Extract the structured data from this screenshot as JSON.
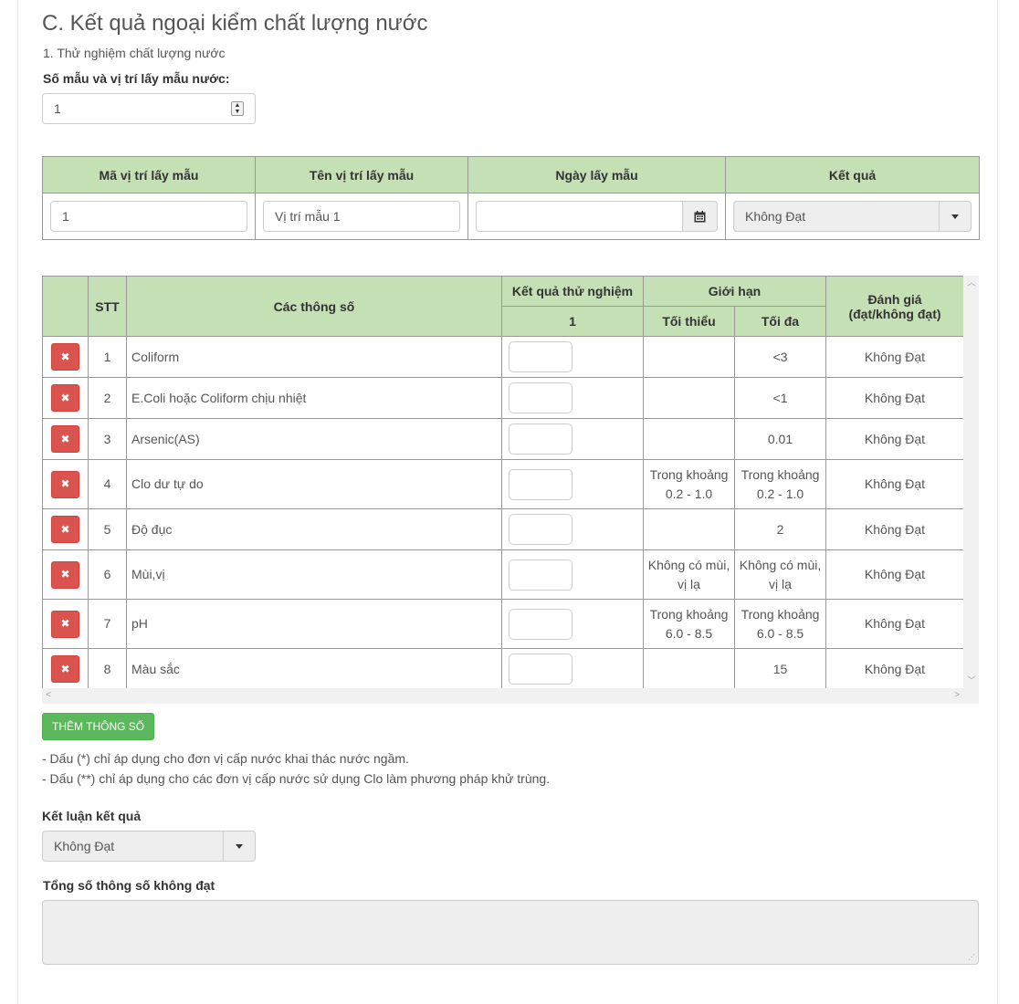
{
  "section": {
    "title": "C. Kết quả ngoại kiểm chất lượng nước",
    "subtitle": "1. Thử nghiệm chất lượng nước",
    "sample_label": "Số mẫu và vị trí lấy mẫu nước:",
    "sample_count": "1"
  },
  "location_table": {
    "headers": [
      "Mã vị trí lấy mẫu",
      "Tên vị trí lấy mẫu",
      "Ngày lấy mẫu",
      "Kết quả"
    ],
    "row": {
      "code": "1",
      "name": "Vị trí mẫu 1",
      "date": "",
      "result": "Không Đạt"
    }
  },
  "params_table": {
    "headers": {
      "stt": "STT",
      "params": "Các thông số",
      "test_result": "Kết quả thử nghiệm",
      "test_result_sub": "1",
      "limit": "Giới hạn",
      "min": "Tối thiểu",
      "max": "Tối đa",
      "eval_line1": "Đánh giá",
      "eval_line2": "(đạt/không đạt)"
    },
    "rows": [
      {
        "stt": "1",
        "name": "Coliform",
        "min": "",
        "max": "<3",
        "eval": "Không Đạt"
      },
      {
        "stt": "2",
        "name": "E.Coli hoặc Coliform chịu nhiệt",
        "min": "",
        "max": "<1",
        "eval": "Không Đạt"
      },
      {
        "stt": "3",
        "name": "Arsenic(AS)",
        "min": "",
        "max": "0.01",
        "eval": "Không Đạt"
      },
      {
        "stt": "4",
        "name": "Clo dư tự do",
        "min": "Trong khoảng 0.2 - 1.0",
        "max": "Trong khoảng 0.2 - 1.0",
        "eval": "Không Đạt"
      },
      {
        "stt": "5",
        "name": "Độ đục",
        "min": "",
        "max": "2",
        "eval": "Không Đạt"
      },
      {
        "stt": "6",
        "name": "Mùi,vị",
        "min": "Không có mùi, vị lạ",
        "max": "Không có mùi, vị lạ",
        "eval": "Không Đạt"
      },
      {
        "stt": "7",
        "name": "pH",
        "min": "Trong khoảng 6.0 - 8.5",
        "max": "Trong khoảng 6.0 - 8.5",
        "eval": "Không Đạt"
      },
      {
        "stt": "8",
        "name": "Màu sắc",
        "min": "",
        "max": "15",
        "eval": "Không Đạt"
      }
    ]
  },
  "buttons": {
    "add_param": "THÊM THÔNG SỐ",
    "delete_icon": "times-icon"
  },
  "notes": [
    "- Dấu (*) chỉ áp dụng cho đơn vị cấp nước khai thác nước ngầm.",
    "- Dấu (**) chỉ áp dụng cho các đơn vị cấp nước sử dụng Clo làm phương pháp khử trùng."
  ],
  "conclusion": {
    "label": "Kết luận kết quả",
    "value": "Không Đạt"
  },
  "total_failed": {
    "label": "Tổng số thông số không đạt",
    "value": ""
  },
  "colors": {
    "header_bg": "#c5e0b4",
    "danger": "#d9534f",
    "success": "#5cb85c"
  }
}
